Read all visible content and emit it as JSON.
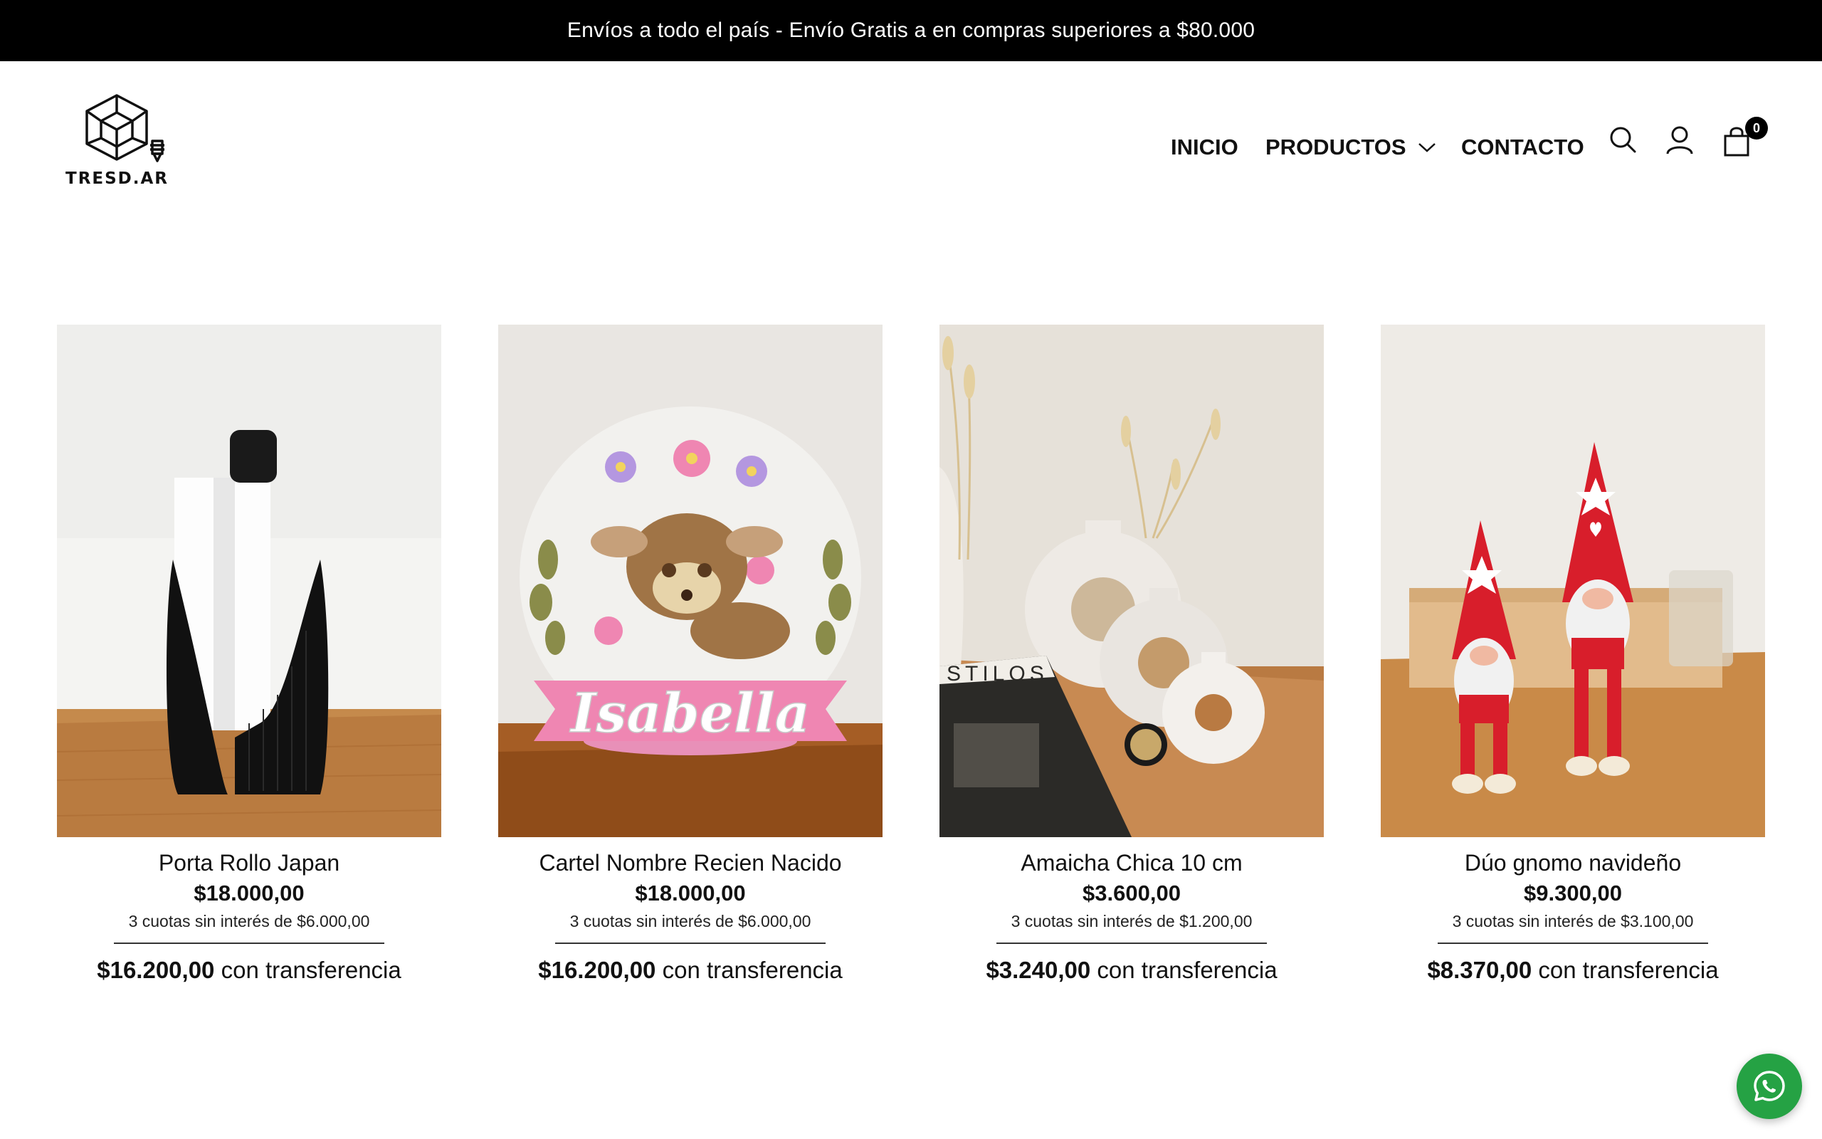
{
  "announcement": "Envíos a todo el país - Envío Gratis a en compras superiores a $80.000",
  "logo": {
    "text": "TRESD.AR"
  },
  "nav": {
    "items": [
      {
        "label": "INICIO"
      },
      {
        "label": "PRODUCTOS",
        "has_dropdown": true
      },
      {
        "label": "CONTACTO"
      }
    ],
    "icons": [
      "search-icon",
      "user-icon",
      "cart-icon"
    ],
    "cart_count": "0"
  },
  "products": [
    {
      "name": "Porta Rollo Japan",
      "price": "$18.000,00",
      "installments": "3 cuotas sin interés de $6.000,00",
      "transfer_price": "$16.200,00",
      "transfer_label": "con transferencia"
    },
    {
      "name": "Cartel Nombre Recien Nacido",
      "price": "$18.000,00",
      "installments": "3 cuotas sin interés de $6.000,00",
      "transfer_price": "$16.200,00",
      "transfer_label": "con transferencia",
      "image_text": "Isabella"
    },
    {
      "name": "Amaicha Chica 10 cm",
      "price": "$3.600,00",
      "installments": "3 cuotas sin interés de $1.200,00",
      "transfer_price": "$3.240,00",
      "transfer_label": "con transferencia",
      "image_text": "STILOS"
    },
    {
      "name": "Dúo gnomo navideño",
      "price": "$9.300,00",
      "installments": "3 cuotas sin interés de $3.100,00",
      "transfer_price": "$8.370,00",
      "transfer_label": "con transferencia"
    }
  ],
  "colors": {
    "announcement_bg": "#000000",
    "whatsapp": "#25a244"
  },
  "floating": {
    "icon": "whatsapp-icon"
  }
}
